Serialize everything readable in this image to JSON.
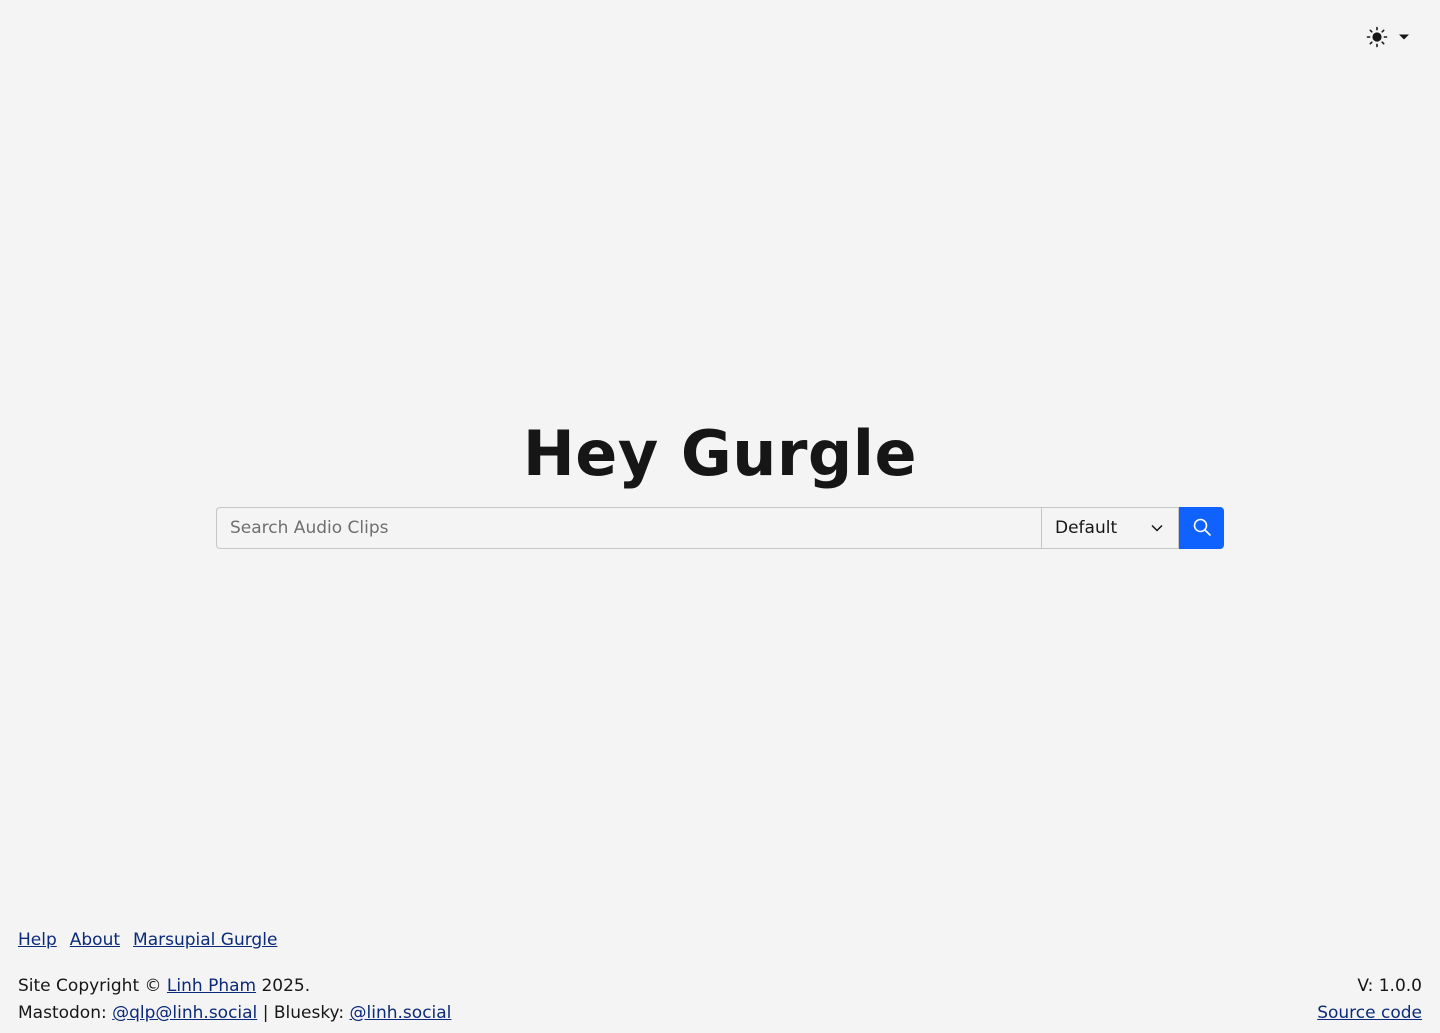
{
  "header": {
    "theme_icon": "sun-icon",
    "dropdown_icon": "caret-down-icon"
  },
  "main": {
    "title": "Hey Gurgle",
    "search": {
      "placeholder": "Search Audio Clips",
      "value": "",
      "select_value": "Default",
      "button_icon": "search-icon"
    }
  },
  "footer": {
    "links": {
      "help": "Help",
      "about": "About",
      "marsupial": "Marsupial Gurgle"
    },
    "copyright_prefix": "Site Copyright ©",
    "copyright_author": "Linh Pham",
    "copyright_year": "2025.",
    "mastodon_label": "Mastodon:",
    "mastodon_handle": "@qlp@linh.social",
    "separator": "|",
    "bluesky_label": "Bluesky:",
    "bluesky_handle": "@linh.social",
    "version": "V: 1.0.0",
    "source_code": "Source code"
  },
  "colors": {
    "background": "#f4f4f4",
    "accent": "#0f62fe",
    "link": "#0b2a7a"
  }
}
